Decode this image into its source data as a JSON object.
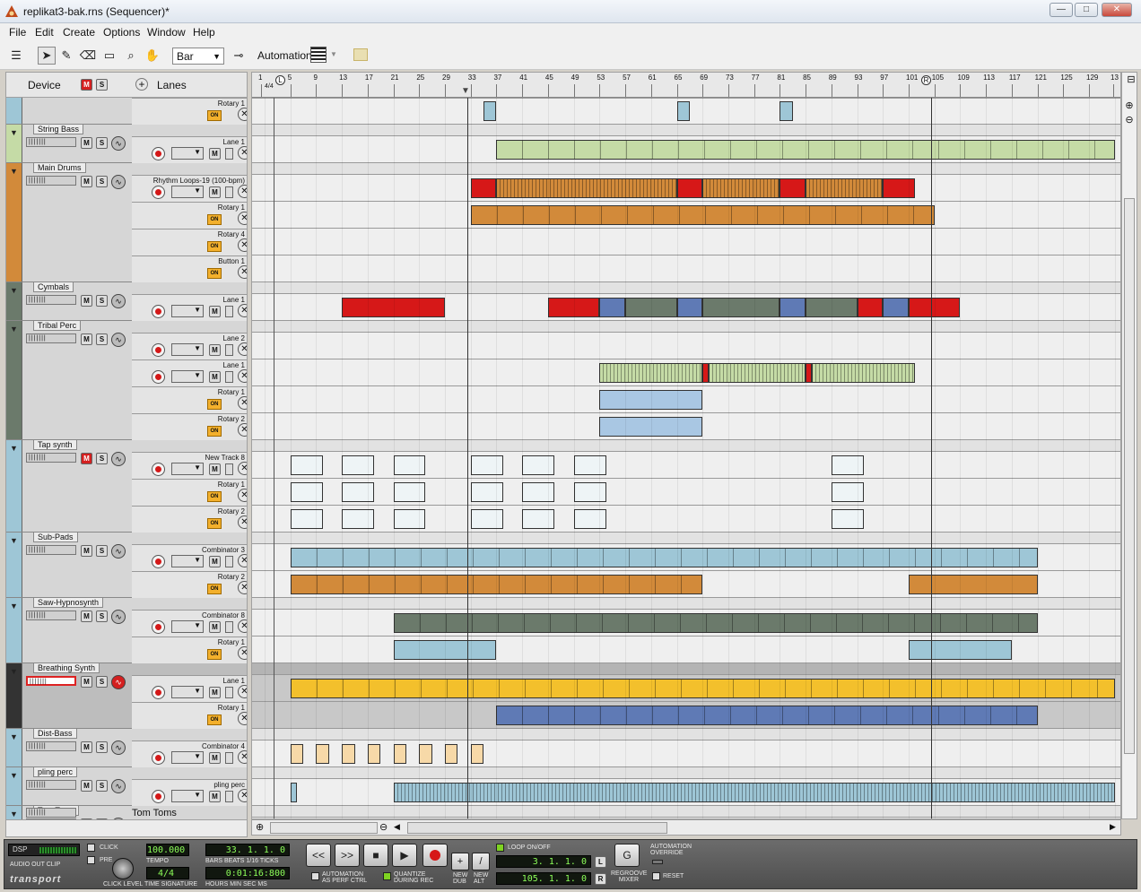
{
  "window": {
    "title": "replikat3-bak.rns (Sequencer)*",
    "min_label": "—",
    "max_label": "□",
    "close_label": "✕"
  },
  "menu": [
    "File",
    "Edit",
    "Create",
    "Options",
    "Window",
    "Help"
  ],
  "toolbar": {
    "snap_value": "Bar",
    "automation_label": "Automation:"
  },
  "header": {
    "device_label": "Device",
    "m_label": "M",
    "s_label": "S",
    "lanes_label": "Lanes"
  },
  "ruler": {
    "time_signature": "4/4",
    "bars": [
      "1",
      "5",
      "9",
      "13",
      "17",
      "21",
      "25",
      "29",
      "33",
      "37",
      "41",
      "45",
      "49",
      "53",
      "57",
      "61",
      "65",
      "69",
      "73",
      "77",
      "81",
      "85",
      "89",
      "93",
      "97",
      "101",
      "105",
      "109",
      "113",
      "117",
      "121",
      "125",
      "129",
      "13"
    ],
    "left_marker": "L",
    "right_marker": "R"
  },
  "tracks": [
    {
      "name": "",
      "lanes": [
        {
          "label": "Rotary 1",
          "type": "auto"
        }
      ]
    },
    {
      "name": "String Bass",
      "lanes": [
        {
          "label": "Lane 1",
          "type": "note"
        }
      ]
    },
    {
      "name": "Main Drums",
      "lanes": [
        {
          "label": "Rhythm Loops-19 (100-bpm)",
          "type": "note"
        },
        {
          "label": "Rotary 1",
          "type": "auto"
        },
        {
          "label": "Rotary 4",
          "type": "auto"
        },
        {
          "label": "Button 1",
          "type": "auto"
        }
      ]
    },
    {
      "name": "Cymbals",
      "lanes": [
        {
          "label": "Lane 1",
          "type": "note"
        }
      ]
    },
    {
      "name": "Tribal Perc",
      "lanes": [
        {
          "label": "Lane 2",
          "type": "note"
        },
        {
          "label": "Lane 1",
          "type": "note"
        },
        {
          "label": "Rotary 1",
          "type": "auto"
        },
        {
          "label": "Rotary 2",
          "type": "auto"
        }
      ]
    },
    {
      "name": "Tap synth",
      "lanes": [
        {
          "label": "New Track 8",
          "type": "note"
        },
        {
          "label": "Rotary 1",
          "type": "auto"
        },
        {
          "label": "Rotary 2",
          "type": "auto"
        }
      ]
    },
    {
      "name": "Sub-Pads",
      "lanes": [
        {
          "label": "Combinator 3",
          "type": "note"
        },
        {
          "label": "Rotary 2",
          "type": "auto"
        }
      ]
    },
    {
      "name": "Saw-Hypnosynth",
      "lanes": [
        {
          "label": "Combinator 8",
          "type": "note"
        },
        {
          "label": "Rotary 1",
          "type": "auto"
        }
      ]
    },
    {
      "name": "Breathing Synth",
      "lanes": [
        {
          "label": "Lane 1",
          "type": "note"
        },
        {
          "label": "Rotary 1",
          "type": "auto"
        }
      ]
    },
    {
      "name": "Dist-Bass",
      "lanes": [
        {
          "label": "Combinator 4",
          "type": "note"
        }
      ]
    },
    {
      "name": "pling perc",
      "lanes": [
        {
          "label": "pling perc",
          "type": "note"
        }
      ]
    },
    {
      "name": "Tom Toms",
      "lanes": []
    }
  ],
  "on_label": "ON",
  "transport": {
    "dsp_label": "DSP",
    "audio_out_clip": "AUDIO OUT CLIP",
    "click_label": "CLICK",
    "pre_label": "PRE",
    "click_level": "CLICK LEVEL",
    "tempo": "100.000",
    "tempo_label": "TEMPO",
    "time_signature": "4/4",
    "time_signature_label": "TIME SIGNATURE",
    "position": "33. 1. 1.   0",
    "position_label": "BARS  BEATS 1/16  TICKS",
    "time": "0:01:16:800",
    "time_label": "HOURS  MIN  SEC  MS",
    "rewind": "<<",
    "forward": ">>",
    "stop": "■",
    "play": "▶",
    "automation_perf": "AUTOMATION AS PERF CTRL",
    "quantize": "QUANTIZE DURING REC",
    "new_dub": "NEW DUB",
    "new_alt": "NEW ALT",
    "loop_label": "LOOP ON/OFF",
    "loop_left": "3. 1. 1.   0",
    "loop_right": "105. 1. 1.   0",
    "l_label": "L",
    "r_label": "R",
    "regroove": "REGROOVE MIXER",
    "override": "AUTOMATION OVERRIDE",
    "reset": "RESET",
    "logo": "transport"
  }
}
